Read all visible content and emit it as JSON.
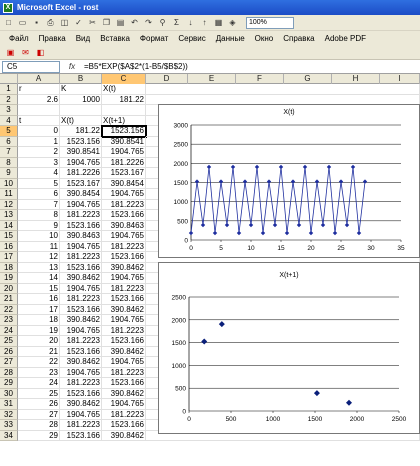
{
  "window": {
    "title": "Microsoft Excel - rost"
  },
  "toolbar": {
    "zoom": "100%"
  },
  "menu": [
    "Файл",
    "Правка",
    "Вид",
    "Вставка",
    "Формат",
    "Сервис",
    "Данные",
    "Окно",
    "Справка",
    "Adobe PDF"
  ],
  "formula_bar": {
    "name_box": "C5",
    "fx": "fx",
    "formula": "=B5*EXP($A$2*(1-B5/$B$2))"
  },
  "columns": [
    "A",
    "B",
    "C",
    "D",
    "E",
    "F",
    "G",
    "H",
    "I"
  ],
  "rows": [
    {
      "n": "1",
      "a": "r",
      "b": "K",
      "c": "X(t)"
    },
    {
      "n": "2",
      "a": "2.6",
      "b": "1000",
      "c": "181.22"
    },
    {
      "n": "3",
      "a": "",
      "b": "",
      "c": ""
    },
    {
      "n": "4",
      "a": "t",
      "b": "X(t)",
      "c": "X(t+1)"
    },
    {
      "n": "5",
      "a": "0",
      "b": "181.22",
      "c": "1523.156"
    },
    {
      "n": "6",
      "a": "1",
      "b": "1523.156",
      "c": "390.8541"
    },
    {
      "n": "7",
      "a": "2",
      "b": "390.8541",
      "c": "1904.765"
    },
    {
      "n": "8",
      "a": "3",
      "b": "1904.765",
      "c": "181.2226"
    },
    {
      "n": "9",
      "a": "4",
      "b": "181.2226",
      "c": "1523.167"
    },
    {
      "n": "10",
      "a": "5",
      "b": "1523.167",
      "c": "390.8454"
    },
    {
      "n": "11",
      "a": "6",
      "b": "390.8454",
      "c": "1904.765"
    },
    {
      "n": "12",
      "a": "7",
      "b": "1904.765",
      "c": "181.2223"
    },
    {
      "n": "13",
      "a": "8",
      "b": "181.2223",
      "c": "1523.166"
    },
    {
      "n": "14",
      "a": "9",
      "b": "1523.166",
      "c": "390.8463"
    },
    {
      "n": "15",
      "a": "10",
      "b": "390.8463",
      "c": "1904.765"
    },
    {
      "n": "16",
      "a": "11",
      "b": "1904.765",
      "c": "181.2223"
    },
    {
      "n": "17",
      "a": "12",
      "b": "181.2223",
      "c": "1523.166"
    },
    {
      "n": "18",
      "a": "13",
      "b": "1523.166",
      "c": "390.8462"
    },
    {
      "n": "19",
      "a": "14",
      "b": "390.8462",
      "c": "1904.765"
    },
    {
      "n": "20",
      "a": "15",
      "b": "1904.765",
      "c": "181.2223"
    },
    {
      "n": "21",
      "a": "16",
      "b": "181.2223",
      "c": "1523.166"
    },
    {
      "n": "22",
      "a": "17",
      "b": "1523.166",
      "c": "390.8462"
    },
    {
      "n": "23",
      "a": "18",
      "b": "390.8462",
      "c": "1904.765"
    },
    {
      "n": "24",
      "a": "19",
      "b": "1904.765",
      "c": "181.2223"
    },
    {
      "n": "25",
      "a": "20",
      "b": "181.2223",
      "c": "1523.166"
    },
    {
      "n": "26",
      "a": "21",
      "b": "1523.166",
      "c": "390.8462"
    },
    {
      "n": "27",
      "a": "22",
      "b": "390.8462",
      "c": "1904.765"
    },
    {
      "n": "28",
      "a": "23",
      "b": "1904.765",
      "c": "181.2223"
    },
    {
      "n": "29",
      "a": "24",
      "b": "181.2223",
      "c": "1523.166"
    },
    {
      "n": "30",
      "a": "25",
      "b": "1523.166",
      "c": "390.8462"
    },
    {
      "n": "31",
      "a": "26",
      "b": "390.8462",
      "c": "1904.765"
    },
    {
      "n": "32",
      "a": "27",
      "b": "1904.765",
      "c": "181.2223"
    },
    {
      "n": "33",
      "a": "28",
      "b": "181.2223",
      "c": "1523.166"
    },
    {
      "n": "34",
      "a": "29",
      "b": "1523.166",
      "c": "390.8462"
    }
  ],
  "chart_data": [
    {
      "type": "line",
      "title": "X(t)",
      "xlim": [
        0,
        35
      ],
      "ylim": [
        0,
        3000
      ],
      "xticks": [
        "0",
        "5",
        "10",
        "15",
        "20",
        "25",
        "30",
        "35"
      ],
      "yticks": [
        "0",
        "500",
        "1000",
        "1500",
        "2000",
        "2500",
        "3000"
      ],
      "x": [
        0,
        1,
        2,
        3,
        4,
        5,
        6,
        7,
        8,
        9,
        10,
        11,
        12,
        13,
        14,
        15,
        16,
        17,
        18,
        19,
        20,
        21,
        22,
        23,
        24,
        25,
        26,
        27,
        28,
        29
      ],
      "values": [
        181.22,
        1523.156,
        390.8541,
        1904.765,
        181.2226,
        1523.167,
        390.8454,
        1904.765,
        181.2223,
        1523.166,
        390.8463,
        1904.765,
        181.2223,
        1523.166,
        390.8462,
        1904.765,
        181.2223,
        1523.166,
        390.8462,
        1904.765,
        181.2223,
        1523.166,
        390.8462,
        1904.765,
        181.2223,
        1523.166,
        390.8462,
        1904.765,
        181.2223,
        1523.166
      ],
      "grid": true,
      "color": "#1f2f9f"
    },
    {
      "type": "scatter",
      "title": "X(t+1)",
      "xlim": [
        0,
        2500
      ],
      "ylim": [
        0,
        2500
      ],
      "xticks": [
        "0",
        "500",
        "1000",
        "1500",
        "2000",
        "2500"
      ],
      "yticks": [
        "0",
        "500",
        "1000",
        "1500",
        "2000",
        "2500"
      ],
      "points": [
        [
          181.22,
          1523.156
        ],
        [
          390.8541,
          1904.765
        ],
        [
          1523.156,
          390.8541
        ],
        [
          1904.765,
          181.2226
        ]
      ],
      "grid": true,
      "color": "#0a1f7a"
    }
  ]
}
